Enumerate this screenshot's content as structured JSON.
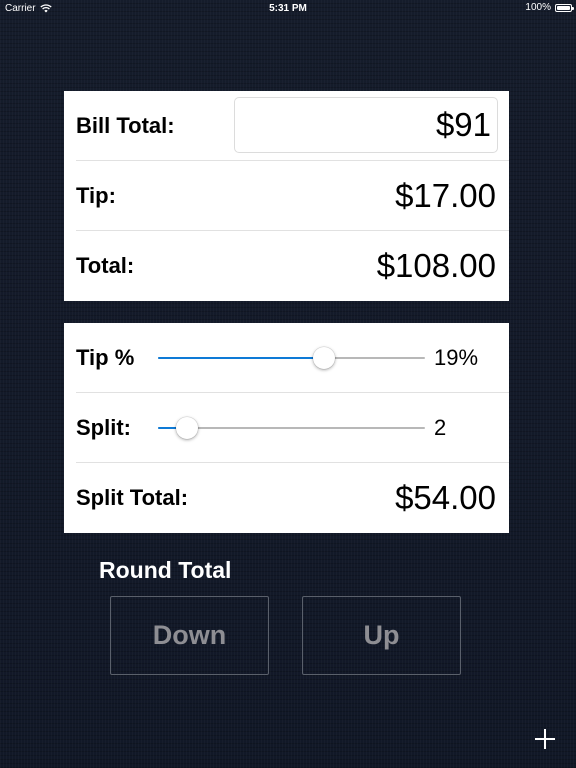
{
  "status_bar": {
    "carrier": "Carrier",
    "wifi_icon": "wifi-icon",
    "time": "5:31 PM",
    "battery_percent": "100%",
    "battery_icon": "battery-icon"
  },
  "bill_card": {
    "bill_total_label": "Bill Total:",
    "bill_total_value": "$91",
    "tip_label": "Tip:",
    "tip_value": "$17.00",
    "total_label": "Total:",
    "total_value": "$108.00"
  },
  "split_card": {
    "tip_percent_label": "Tip %",
    "tip_percent_value": "19%",
    "tip_slider_fraction": 0.62,
    "split_label": "Split:",
    "split_value": "2",
    "split_slider_fraction": 0.11,
    "split_total_label": "Split Total:",
    "split_total_value": "$54.00"
  },
  "round": {
    "title": "Round Total",
    "down_label": "Down",
    "up_label": "Up"
  },
  "toolbar": {
    "add_icon": "plus-icon"
  },
  "colors": {
    "background": "#131a28",
    "card": "#ffffff",
    "slider_fill": "#0e7ad6",
    "button_text": "#8e8e93",
    "button_border": "#5a606b"
  }
}
